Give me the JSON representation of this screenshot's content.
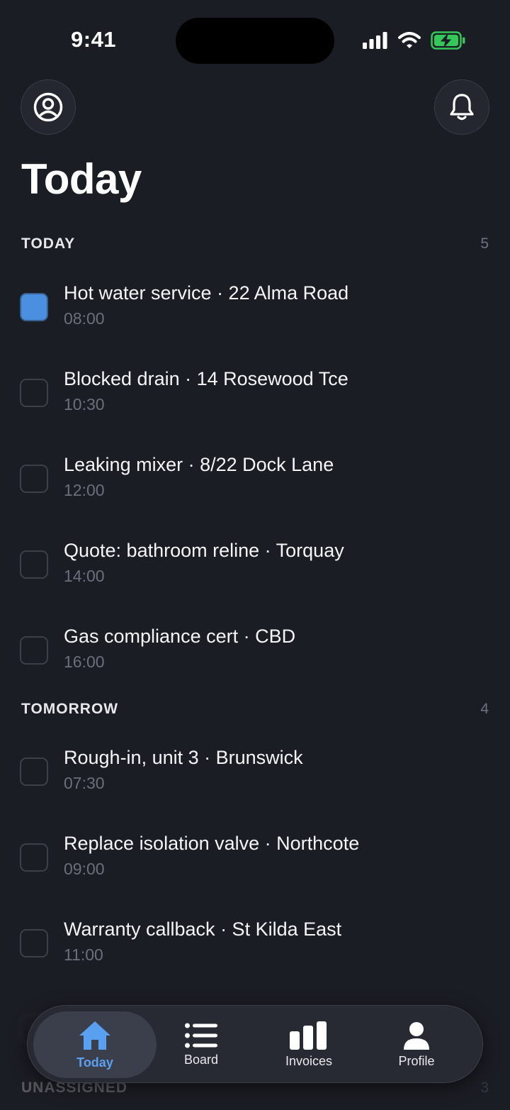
{
  "status_bar": {
    "time": "9:41"
  },
  "header": {
    "title": "Today"
  },
  "sections": {
    "today": {
      "label": "TODAY",
      "count": "5",
      "jobs": [
        {
          "title": "Hot water service · 22 Alma Road",
          "time": "08:00",
          "checked": true
        },
        {
          "title": "Blocked drain · 14 Rosewood Tce",
          "time": "10:30",
          "checked": false
        },
        {
          "title": "Leaking mixer · 8/22 Dock Lane",
          "time": "12:00",
          "checked": false
        },
        {
          "title": "Quote: bathroom reline · Torquay",
          "time": "14:00",
          "checked": false
        },
        {
          "title": "Gas compliance cert · CBD",
          "time": "16:00",
          "checked": false
        }
      ]
    },
    "tomorrow": {
      "label": "TOMORROW",
      "count": "4",
      "jobs": [
        {
          "title": "Rough-in, unit 3 · Brunswick",
          "time": "07:30",
          "checked": false
        },
        {
          "title": "Replace isolation valve · Northcote",
          "time": "09:00",
          "checked": false
        },
        {
          "title": "Warranty callback · St Kilda East",
          "time": "11:00",
          "checked": false
        }
      ]
    },
    "unassigned": {
      "label": "UNASSIGNED",
      "count": "3"
    }
  },
  "tab_bar": {
    "tabs": [
      {
        "label": "Today",
        "icon": "house-icon",
        "active": true
      },
      {
        "label": "Board",
        "icon": "list-icon",
        "active": false
      },
      {
        "label": "Invoices",
        "icon": "bar-chart-icon",
        "active": false
      },
      {
        "label": "Profile",
        "icon": "person-icon",
        "active": false
      }
    ]
  },
  "colors": {
    "background": "#1b1d24",
    "accent": "#4a8fe0",
    "battery": "#34c759"
  }
}
